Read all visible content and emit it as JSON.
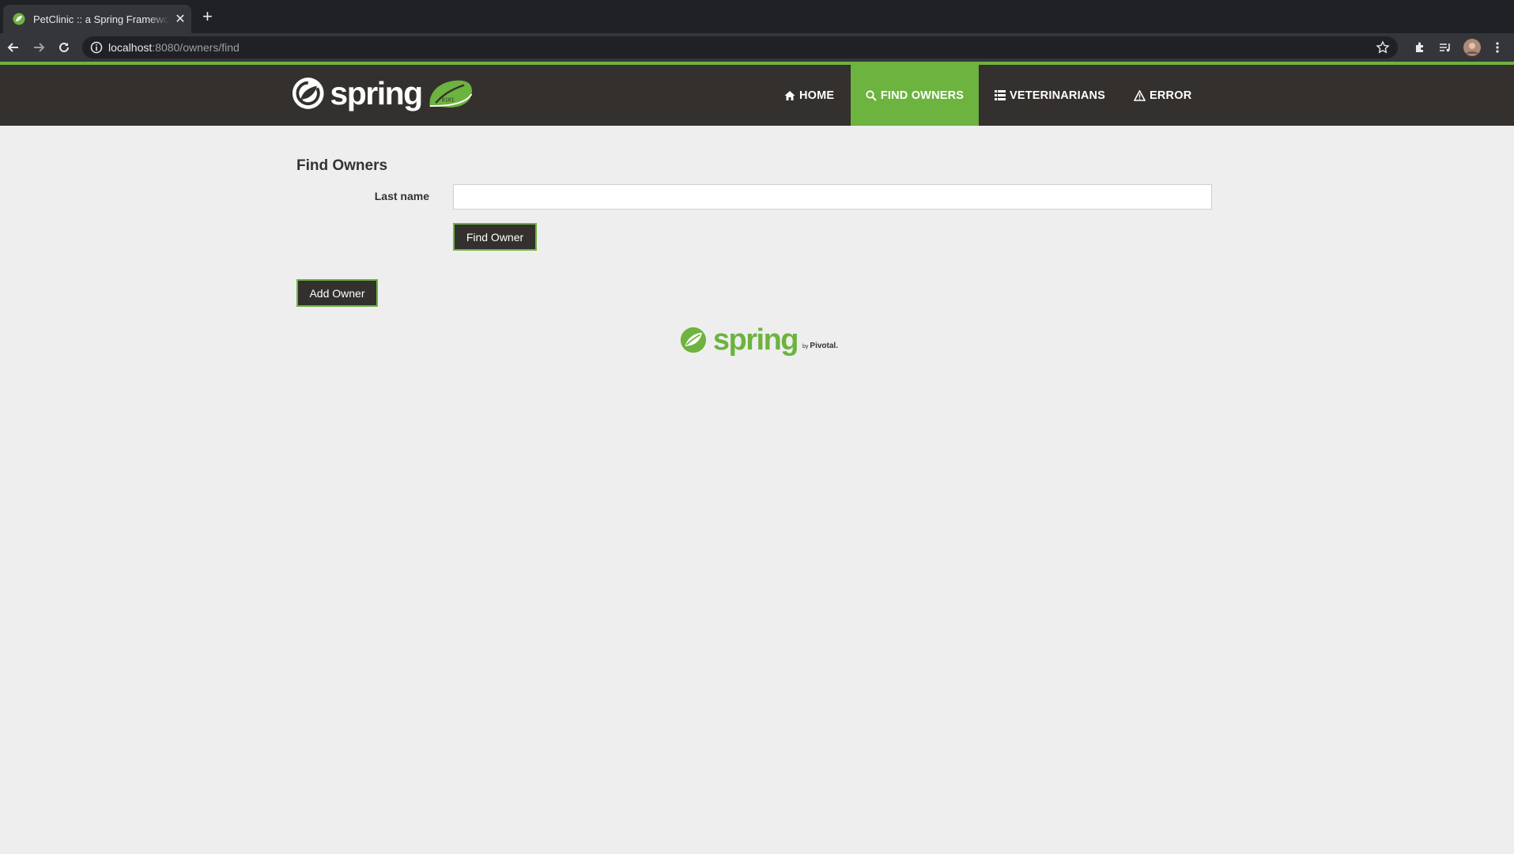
{
  "browser": {
    "tab_title": "PetClinic :: a Spring Framework demonstration",
    "url_host": "localhost",
    "url_path": ":8080/owners/find"
  },
  "navbar": {
    "brand": "spring",
    "items": [
      {
        "label": "HOME",
        "icon": "home-icon",
        "active": false
      },
      {
        "label": "FIND OWNERS",
        "icon": "search-icon",
        "active": true
      },
      {
        "label": "VETERINARIANS",
        "icon": "list-icon",
        "active": false
      },
      {
        "label": "ERROR",
        "icon": "warning-icon",
        "active": false
      }
    ]
  },
  "page": {
    "title": "Find Owners",
    "last_name_label": "Last name",
    "last_name_value": "",
    "find_button": "Find Owner",
    "add_button": "Add Owner"
  },
  "footer": {
    "brand": "spring",
    "by": "by",
    "vendor": "Pivotal."
  },
  "colors": {
    "accent": "#6db33f",
    "navbar_bg": "#34302d",
    "page_bg": "#eeeeee"
  }
}
